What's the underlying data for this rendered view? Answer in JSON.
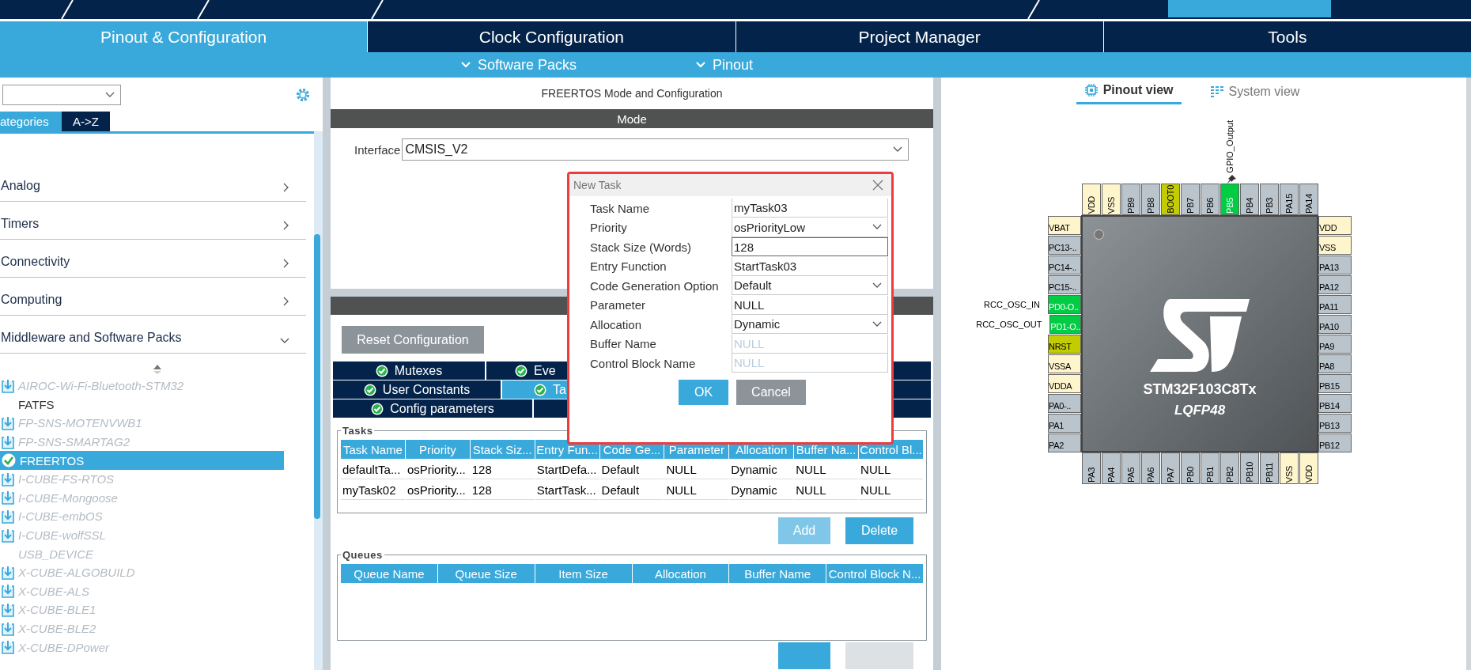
{
  "main_tabs": [
    {
      "label": "Pinout & Configuration",
      "selected": true
    },
    {
      "label": "Clock Configuration",
      "selected": false
    },
    {
      "label": "Project Manager",
      "selected": false
    },
    {
      "label": "Tools",
      "selected": false
    }
  ],
  "sub_tabs": [
    {
      "label": "Software Packs"
    },
    {
      "label": "Pinout"
    }
  ],
  "sidebar": {
    "view_tabs": [
      {
        "label": "ategories",
        "selected": true
      },
      {
        "label": "A->Z",
        "selected": false
      }
    ],
    "categories": [
      {
        "label": "Analog",
        "expanded": false
      },
      {
        "label": "Timers",
        "expanded": false
      },
      {
        "label": "Connectivity",
        "expanded": false
      },
      {
        "label": "Computing",
        "expanded": false
      },
      {
        "label": "Middleware and Software Packs",
        "expanded": true
      }
    ],
    "items": [
      {
        "label": "AIROC-Wi-Fi-Bluetooth-STM32",
        "kind": "download",
        "disabled": true,
        "selected": false
      },
      {
        "label": "FATFS",
        "kind": "plain",
        "disabled": false,
        "selected": false
      },
      {
        "label": "FP-SNS-MOTENVWB1",
        "kind": "download",
        "disabled": true,
        "selected": false
      },
      {
        "label": "FP-SNS-SMARTAG2",
        "kind": "download",
        "disabled": true,
        "selected": false
      },
      {
        "label": "FREERTOS",
        "kind": "check",
        "disabled": false,
        "selected": true
      },
      {
        "label": "I-CUBE-FS-RTOS",
        "kind": "download",
        "disabled": true,
        "selected": false
      },
      {
        "label": "I-CUBE-Mongoose",
        "kind": "download",
        "disabled": true,
        "selected": false
      },
      {
        "label": "I-CUBE-embOS",
        "kind": "download",
        "disabled": true,
        "selected": false
      },
      {
        "label": "I-CUBE-wolfSSL",
        "kind": "download",
        "disabled": true,
        "selected": false
      },
      {
        "label": "USB_DEVICE",
        "kind": "plain",
        "disabled": true,
        "selected": false
      },
      {
        "label": "X-CUBE-ALGOBUILD",
        "kind": "download",
        "disabled": true,
        "selected": false
      },
      {
        "label": "X-CUBE-ALS",
        "kind": "download",
        "disabled": true,
        "selected": false
      },
      {
        "label": "X-CUBE-BLE1",
        "kind": "download",
        "disabled": true,
        "selected": false
      },
      {
        "label": "X-CUBE-BLE2",
        "kind": "download",
        "disabled": true,
        "selected": false
      },
      {
        "label": "X-CUBE-DPower",
        "kind": "download",
        "disabled": true,
        "selected": false
      }
    ]
  },
  "mode_panel": {
    "title": "FREERTOS Mode and Configuration",
    "section": "Mode",
    "interface_label": "Interface",
    "interface_value": "CMSIS_V2"
  },
  "config": {
    "reset_button": "Reset Configuration",
    "tab_rows": [
      [
        {
          "label": "Mutexes",
          "selected": false
        },
        {
          "label": "Eve",
          "selected": false
        }
      ],
      [
        {
          "label": "User Constants",
          "selected": false
        },
        {
          "label": "Ta",
          "selected": true
        }
      ],
      [
        {
          "label": "Config parameters",
          "selected": false
        }
      ]
    ],
    "tasks": {
      "legend": "Tasks",
      "columns": [
        "Task Name",
        "Priority",
        "Stack Siz...",
        "Entry Fun...",
        "Code Ge...",
        "Parameter",
        "Allocation",
        "Buffer Na...",
        "Control Bl..."
      ],
      "rows": [
        [
          "defaultTa...",
          "osPriority...",
          "128",
          "StartDefa...",
          "Default",
          "NULL",
          "Dynamic",
          "NULL",
          "NULL"
        ],
        [
          "myTask02",
          "osPriority...",
          "128",
          "StartTask...",
          "Default",
          "NULL",
          "Dynamic",
          "NULL",
          "NULL"
        ]
      ],
      "buttons": [
        {
          "label": "Add",
          "disabled": true
        },
        {
          "label": "Delete",
          "disabled": false
        }
      ]
    },
    "queues": {
      "legend": "Queues",
      "columns": [
        "Queue Name",
        "Queue Size",
        "Item Size",
        "Allocation",
        "Buffer Name",
        "Control Block N..."
      ]
    }
  },
  "dialog": {
    "title": "New Task",
    "fields": [
      {
        "label": "Task Name",
        "kind": "text",
        "value": "myTask03",
        "disabled": false
      },
      {
        "label": "Priority",
        "kind": "select",
        "value": "osPriorityLow",
        "disabled": false
      },
      {
        "label": "Stack Size (Words)",
        "kind": "text",
        "value": "128",
        "disabled": false
      },
      {
        "label": "Entry Function",
        "kind": "text",
        "value": "StartTask03",
        "disabled": false
      },
      {
        "label": "Code Generation Option",
        "kind": "select",
        "value": "Default",
        "disabled": false
      },
      {
        "label": "Parameter",
        "kind": "text",
        "value": "NULL",
        "disabled": false
      },
      {
        "label": "Allocation",
        "kind": "select",
        "value": "Dynamic",
        "disabled": false
      },
      {
        "label": "Buffer Name",
        "kind": "text",
        "value": "NULL",
        "disabled": true
      },
      {
        "label": "Control Block Name",
        "kind": "text",
        "value": "NULL",
        "disabled": true
      }
    ],
    "buttons": [
      {
        "label": "OK",
        "kind": "primary"
      },
      {
        "label": "Cancel",
        "kind": "secondary"
      }
    ]
  },
  "pinout": {
    "view_tabs": [
      {
        "label": "Pinout view",
        "selected": true
      },
      {
        "label": "System view",
        "selected": false
      }
    ],
    "chip": {
      "name": "STM32F103C8Tx",
      "package": "LQFP48"
    },
    "top": [
      {
        "name": "VDD",
        "color": "#fff5cc"
      },
      {
        "name": "VSS",
        "color": "#fff5cc"
      },
      {
        "name": "PB9",
        "color": "#b9c4cc"
      },
      {
        "name": "PB8",
        "color": "#b9c4cc"
      },
      {
        "name": "BOOT0",
        "color": "#c2cc00"
      },
      {
        "name": "PB7",
        "color": "#b9c4cc"
      },
      {
        "name": "PB6",
        "color": "#b9c4cc"
      },
      {
        "name": "PB5",
        "color": "#00cc44",
        "signal": "GPIO_Output"
      },
      {
        "name": "PB4",
        "color": "#b9c4cc"
      },
      {
        "name": "PB3",
        "color": "#b9c4cc"
      },
      {
        "name": "PA15",
        "color": "#b9c4cc"
      },
      {
        "name": "PA14",
        "color": "#b9c4cc"
      }
    ],
    "left": [
      {
        "name": "VBAT",
        "color": "#fff5cc"
      },
      {
        "name": "PC13-..",
        "color": "#b9c4cc"
      },
      {
        "name": "PC14-..",
        "color": "#b9c4cc"
      },
      {
        "name": "PC15-..",
        "color": "#b9c4cc"
      },
      {
        "name": "PD0-O..",
        "color": "#00cc44",
        "signal": "RCC_OSC_IN"
      },
      {
        "name": "PD1-O..",
        "color": "#00cc44",
        "signal": "RCC_OSC_OUT"
      },
      {
        "name": "NRST",
        "color": "#c2cc00"
      },
      {
        "name": "VSSA",
        "color": "#fff5cc"
      },
      {
        "name": "VDDA",
        "color": "#fff5cc"
      },
      {
        "name": "PA0-..",
        "color": "#b9c4cc"
      },
      {
        "name": "PA1",
        "color": "#b9c4cc"
      },
      {
        "name": "PA2",
        "color": "#b9c4cc"
      }
    ],
    "right": [
      {
        "name": "VDD",
        "color": "#fff5cc"
      },
      {
        "name": "VSS",
        "color": "#fff5cc"
      },
      {
        "name": "PA13",
        "color": "#b9c4cc"
      },
      {
        "name": "PA12",
        "color": "#b9c4cc"
      },
      {
        "name": "PA11",
        "color": "#b9c4cc"
      },
      {
        "name": "PA10",
        "color": "#b9c4cc"
      },
      {
        "name": "PA9",
        "color": "#b9c4cc"
      },
      {
        "name": "PA8",
        "color": "#b9c4cc"
      },
      {
        "name": "PB15",
        "color": "#b9c4cc"
      },
      {
        "name": "PB14",
        "color": "#b9c4cc"
      },
      {
        "name": "PB13",
        "color": "#b9c4cc"
      },
      {
        "name": "PB12",
        "color": "#b9c4cc"
      }
    ],
    "bottom": [
      {
        "name": "PA3",
        "color": "#b9c4cc"
      },
      {
        "name": "PA4",
        "color": "#b9c4cc"
      },
      {
        "name": "PA5",
        "color": "#b9c4cc"
      },
      {
        "name": "PA6",
        "color": "#b9c4cc"
      },
      {
        "name": "PA7",
        "color": "#b9c4cc"
      },
      {
        "name": "PB0",
        "color": "#b9c4cc"
      },
      {
        "name": "PB1",
        "color": "#b9c4cc"
      },
      {
        "name": "PB2",
        "color": "#b9c4cc"
      },
      {
        "name": "PB10",
        "color": "#b9c4cc"
      },
      {
        "name": "PB11",
        "color": "#b9c4cc"
      },
      {
        "name": "VSS",
        "color": "#fff5cc"
      },
      {
        "name": "VDD",
        "color": "#fff5cc"
      }
    ]
  }
}
